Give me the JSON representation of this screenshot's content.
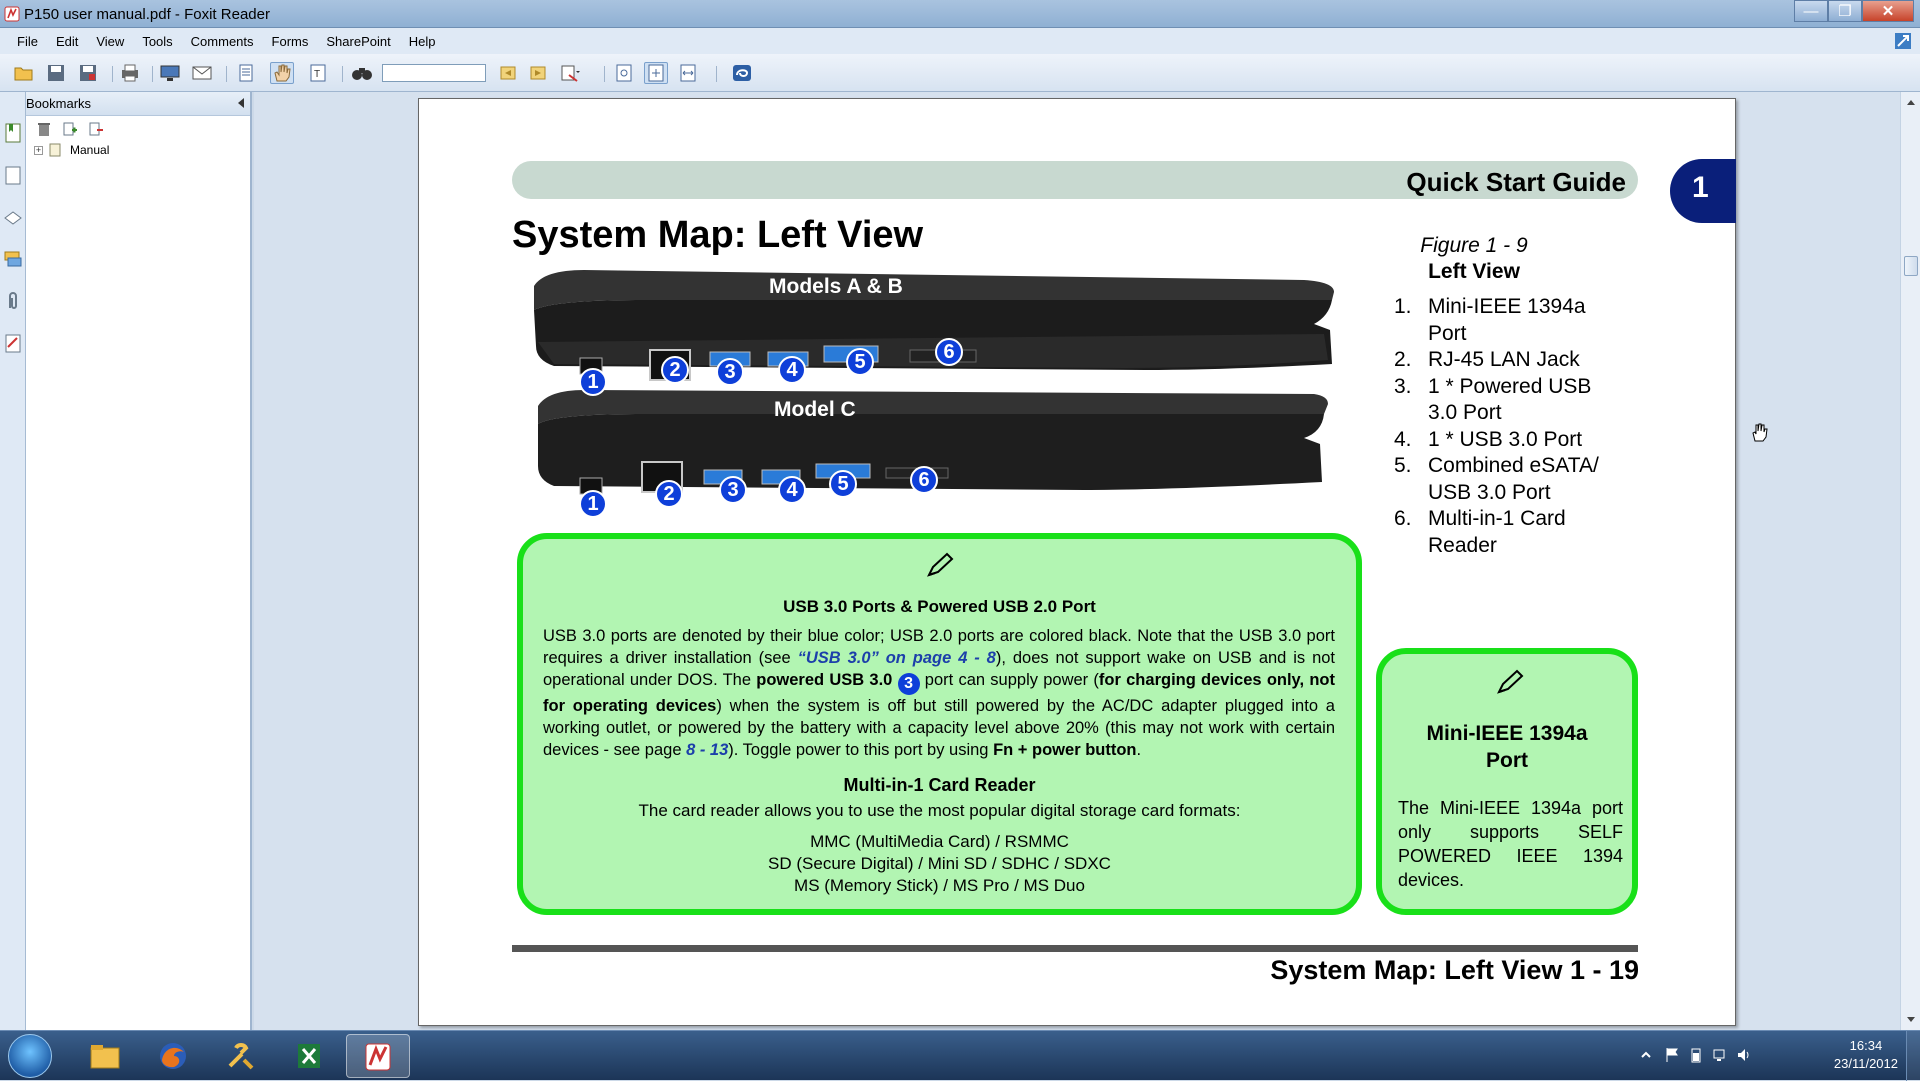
{
  "window": {
    "title": "P150 user manual.pdf - Foxit Reader"
  },
  "menu": [
    "File",
    "Edit",
    "View",
    "Tools",
    "Comments",
    "Forms",
    "SharePoint",
    "Help"
  ],
  "toolbar": {
    "find_value": ""
  },
  "bookmarks": {
    "title": "Bookmarks",
    "items": [
      {
        "label": "Manual",
        "expanded": false
      }
    ]
  },
  "page": {
    "chapter_banner": "Quick Start Guide",
    "chapter_number": "1",
    "heading": "System Map: Left View",
    "laptops": {
      "top_label": "Models A & B",
      "bottom_label": "Model C",
      "callouts": [
        "1",
        "2",
        "3",
        "4",
        "5",
        "6"
      ]
    },
    "figure": {
      "number": "Figure 1 - 9",
      "title": "Left View",
      "items": [
        {
          "n": "1.",
          "text": "Mini-IEEE 1394a Port"
        },
        {
          "n": "2.",
          "text": "RJ-45 LAN Jack"
        },
        {
          "n": "3.",
          "text": "1 * Powered USB 3.0 Port"
        },
        {
          "n": "4.",
          "text": "1 * USB 3.0 Port"
        },
        {
          "n": "5.",
          "text": "Combined eSATA/ USB 3.0 Port"
        },
        {
          "n": "6.",
          "text": "Multi-in-1 Card Reader"
        }
      ]
    },
    "usb_box": {
      "heading": "USB 3.0 Ports & Powered USB 2.0 Port",
      "p1": "USB 3.0 ports are denoted by their blue color; USB 2.0 ports are colored black. Note that the USB 3.0 port requires a driver installation (see ",
      "link1": "“USB 3.0” on page 4 - 8",
      "p2": "), does not support wake on USB and is not operational under DOS. The ",
      "bold1": "powered USB 3.0",
      "inline_num": "3",
      "p3": " port can supply power (",
      "bold2": "for charging devices only, not for operating devices",
      "p4": ") when the system is off but still powered by the AC/DC adapter plugged into a working outlet, or powered by the battery with a capacity level above 20% (this may not work with certain devices - see page ",
      "link2": "8 - 13",
      "p5": "). Toggle power to this port by using ",
      "bold3": "Fn + power button",
      "p6": ".",
      "card_heading": "Multi-in-1 Card Reader",
      "card_text": "The card reader allows you to use the most popular digital storage card formats:",
      "formats": [
        "MMC (MultiMedia Card) / RSMMC",
        "SD (Secure Digital) / Mini SD / SDHC / SDXC",
        "MS (Memory Stick) / MS Pro / MS Duo"
      ]
    },
    "mini_box": {
      "heading_line1": "Mini-IEEE 1394a",
      "heading_line2": "Port",
      "body": "The Mini-IEEE 1394a port only supports SELF POWERED IEEE 1394 devices."
    },
    "footer": "System Map: Left View 1 - 19"
  },
  "taskbar": {
    "time": "16:34",
    "date": "23/11/2012"
  },
  "colors": {
    "callout_blue": "#0e3fd9",
    "box_green": "#19e019",
    "box_fill": "#b2f5b2",
    "chapter_tab": "#0a1f7a"
  }
}
